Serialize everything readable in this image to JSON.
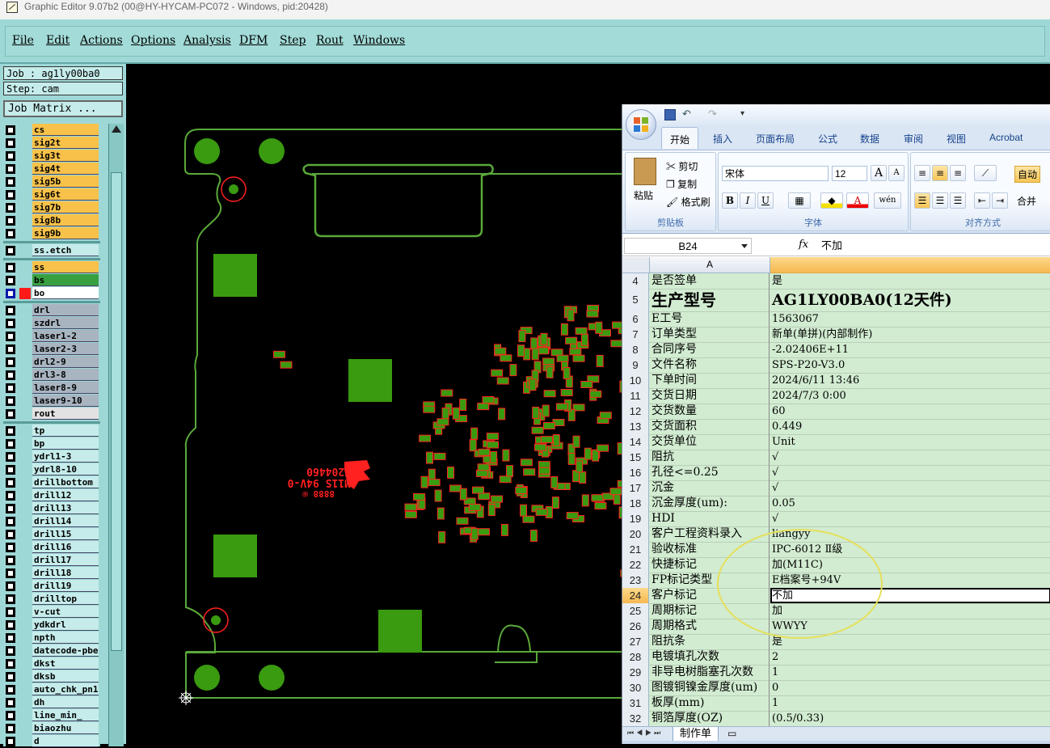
{
  "window": {
    "title": "Graphic Editor 9.07b2 (00@HY-HYCAM-PC072 - Windows, pid:20428)"
  },
  "menu": {
    "items": [
      "File",
      "Edit",
      "Actions",
      "Options",
      "Analysis",
      "DFM",
      "Step",
      "Rout",
      "Windows"
    ]
  },
  "job": {
    "job_label": "Job : ag1ly00ba0",
    "step_label": "Step: cam",
    "matrix_button": "Job Matrix ..."
  },
  "layers": [
    {
      "name": "cs",
      "color": "#f8c24a"
    },
    {
      "name": "sig2t",
      "color": "#f8c24a"
    },
    {
      "name": "sig3t",
      "color": "#f8c24a"
    },
    {
      "name": "sig4t",
      "color": "#f8c24a"
    },
    {
      "name": "sig5b",
      "color": "#f8c24a"
    },
    {
      "name": "sig6t",
      "color": "#f8c24a"
    },
    {
      "name": "sig7b",
      "color": "#f8c24a"
    },
    {
      "name": "sig8b",
      "color": "#f8c24a"
    },
    {
      "name": "sig9b",
      "color": "#f8c24a"
    },
    {
      "name": "ss.etch",
      "color": "#c5ecea"
    },
    {
      "name": "ss",
      "color": "#f8c24a"
    },
    {
      "name": "bs",
      "color": "#38a040"
    },
    {
      "name": "bo",
      "color": "#ffffff"
    },
    {
      "name": "drl",
      "color": "#a8b4c0"
    },
    {
      "name": "szdrl",
      "color": "#a8b4c0"
    },
    {
      "name": "laser1-2",
      "color": "#a8b4c0"
    },
    {
      "name": "laser2-3",
      "color": "#a8b4c0"
    },
    {
      "name": "drl2-9",
      "color": "#a8b4c0"
    },
    {
      "name": "drl3-8",
      "color": "#a8b4c0"
    },
    {
      "name": "laser8-9",
      "color": "#a8b4c0"
    },
    {
      "name": "laser9-10",
      "color": "#a8b4c0"
    },
    {
      "name": "rout",
      "color": "#e2e2e2"
    },
    {
      "name": "tp",
      "color": "#c5ecea"
    },
    {
      "name": "bp",
      "color": "#c5ecea"
    },
    {
      "name": "ydrl1-3",
      "color": "#c5ecea"
    },
    {
      "name": "ydrl8-10",
      "color": "#c5ecea"
    },
    {
      "name": "drillbottom",
      "color": "#c5ecea"
    },
    {
      "name": "drill12",
      "color": "#c5ecea"
    },
    {
      "name": "drill13",
      "color": "#c5ecea"
    },
    {
      "name": "drill14",
      "color": "#c5ecea"
    },
    {
      "name": "drill15",
      "color": "#c5ecea"
    },
    {
      "name": "drill16",
      "color": "#c5ecea"
    },
    {
      "name": "drill17",
      "color": "#c5ecea"
    },
    {
      "name": "drill18",
      "color": "#c5ecea"
    },
    {
      "name": "drill19",
      "color": "#c5ecea"
    },
    {
      "name": "drilltop",
      "color": "#c5ecea"
    },
    {
      "name": "v-cut",
      "color": "#c5ecea"
    },
    {
      "name": "ydkdrl",
      "color": "#c5ecea"
    },
    {
      "name": "npth",
      "color": "#c5ecea"
    },
    {
      "name": "datecode-pbe",
      "color": "#c5ecea"
    },
    {
      "name": "dkst",
      "color": "#c5ecea"
    },
    {
      "name": "dksb",
      "color": "#c5ecea"
    },
    {
      "name": "auto_chk_pn1",
      "color": "#c5ecea"
    },
    {
      "name": "dh",
      "color": "#c5ecea"
    },
    {
      "name": "line_min_",
      "color": "#c5ecea"
    },
    {
      "name": "biaozhu",
      "color": "#c5ecea"
    },
    {
      "name": "d",
      "color": "#c5ecea"
    }
  ],
  "board": {
    "marking_lines": [
      "E204460",
      "M11S 94V-0",
      "8888 ®"
    ],
    "colors": {
      "copper": "#3a9a10",
      "outline": "#5aa83a",
      "marking": "#ff2020"
    }
  },
  "excel": {
    "tabs": [
      "开始",
      "插入",
      "页面布局",
      "公式",
      "数据",
      "审阅",
      "视图",
      "Acrobat"
    ],
    "clipboard": {
      "paste": "粘贴",
      "cut": "剪切",
      "copy": "复制",
      "format_painter": "格式刷",
      "group_label": "剪贴板"
    },
    "font": {
      "name": "宋体",
      "size": "12",
      "bold": "B",
      "italic": "I",
      "underline": "U",
      "grow": "A",
      "shrink": "A",
      "group_label": "字体"
    },
    "alignment": {
      "wrap": "自动",
      "merge": "合并",
      "group_label": "对齐方式"
    },
    "formula_bar": {
      "name_box": "B24",
      "fx": "fx",
      "value": "不加"
    },
    "column_header": "A",
    "rows": [
      {
        "n": "4",
        "a": "是否签单",
        "b": "是"
      },
      {
        "n": "5",
        "a": "生产型号",
        "b": "AG1LY00BA0(12天件)",
        "big": true
      },
      {
        "n": "6",
        "a": "E工号",
        "b": "1563067"
      },
      {
        "n": "7",
        "a": "订单类型",
        "b": "新单(单拼)(内部制作)"
      },
      {
        "n": "8",
        "a": "合同序号",
        "b": "-2.02406E+11"
      },
      {
        "n": "9",
        "a": "文件名称",
        "b": "SPS-P20-V3.0"
      },
      {
        "n": "10",
        "a": "下单时间",
        "b": "2024/6/11 13:46"
      },
      {
        "n": "11",
        "a": "交货日期",
        "b": "2024/7/3 0:00"
      },
      {
        "n": "12",
        "a": "交货数量",
        "b": "60"
      },
      {
        "n": "13",
        "a": "交货面积",
        "b": "0.449"
      },
      {
        "n": "14",
        "a": "交货单位",
        "b": "Unit"
      },
      {
        "n": "15",
        "a": "阻抗",
        "b": "√"
      },
      {
        "n": "16",
        "a": "孔径<=0.25",
        "b": "√"
      },
      {
        "n": "17",
        "a": "沉金",
        "b": "√"
      },
      {
        "n": "18",
        "a": "沉金厚度(um):",
        "b": "0.05"
      },
      {
        "n": "19",
        "a": "HDI",
        "b": "√"
      },
      {
        "n": "20",
        "a": "客户工程资料录入",
        "b": "liangyy"
      },
      {
        "n": "21",
        "a": "验收标准",
        "b": "IPC-6012 Ⅱ级"
      },
      {
        "n": "22",
        "a": "快捷标记",
        "b": "加(M11C)"
      },
      {
        "n": "23",
        "a": "FP标记类型",
        "b": "E档案号+94V"
      },
      {
        "n": "24",
        "a": "客户标记",
        "b": "不加",
        "selected": true
      },
      {
        "n": "25",
        "a": "周期标记",
        "b": "加"
      },
      {
        "n": "26",
        "a": "周期格式",
        "b": "WWYY"
      },
      {
        "n": "27",
        "a": "阻抗条",
        "b": "是"
      },
      {
        "n": "28",
        "a": "电镀填孔次数",
        "b": "2"
      },
      {
        "n": "29",
        "a": "非导电树脂塞孔次数",
        "b": "1"
      },
      {
        "n": "30",
        "a": "图镀铜镍金厚度(um)",
        "b": "0"
      },
      {
        "n": "31",
        "a": "板厚(mm)",
        "b": "1"
      },
      {
        "n": "32",
        "a": "铜箔厚度(OZ)",
        "b": "(0.5/0.33)"
      }
    ],
    "sheet_tab": "制作单"
  }
}
